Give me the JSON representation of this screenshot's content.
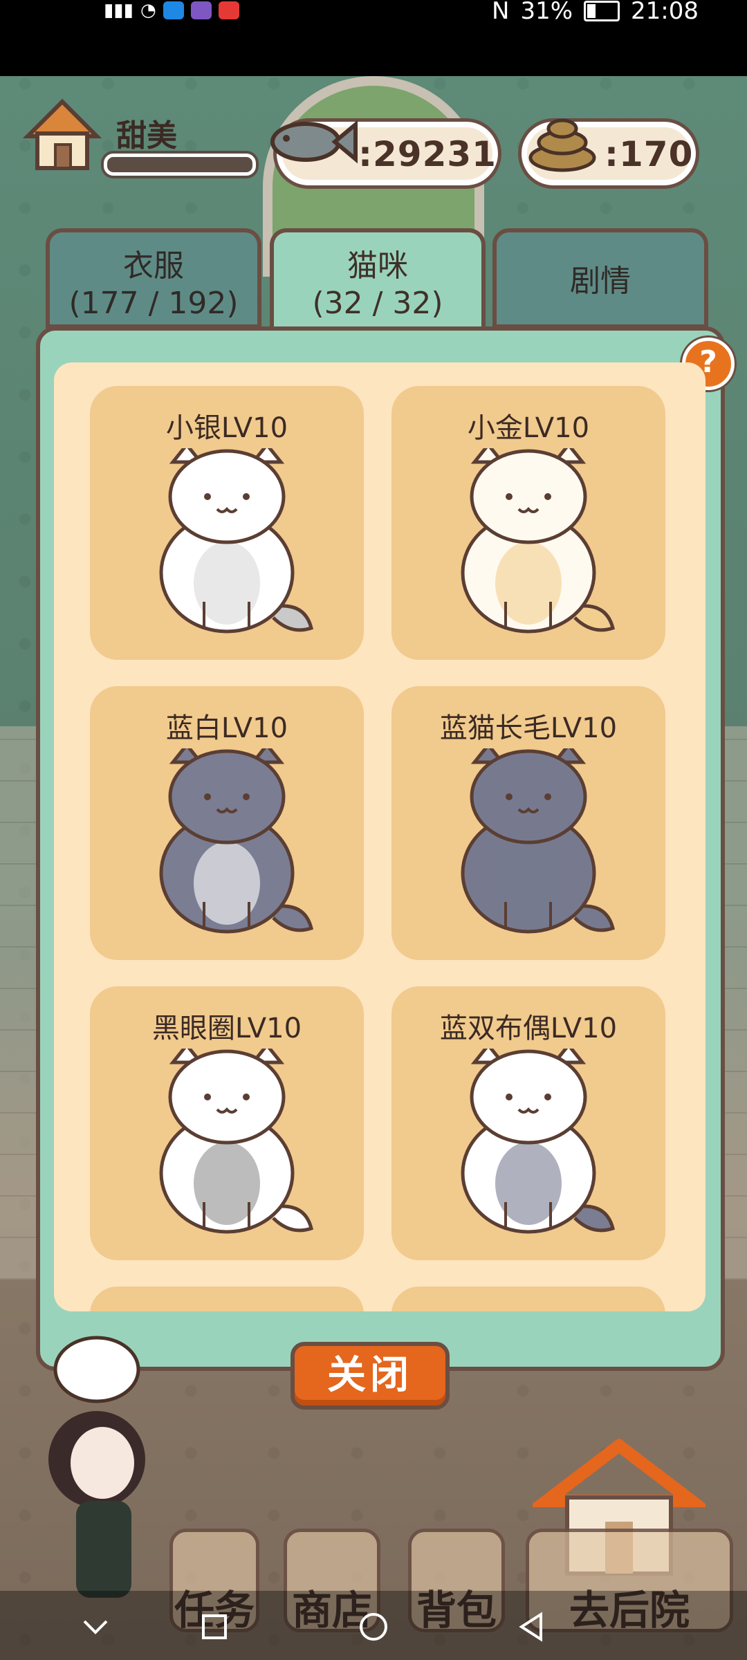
{
  "status_bar": {
    "battery": "31%",
    "time": "21:08"
  },
  "hud": {
    "player_name": "甜美",
    "fish_count": ":29231",
    "poop_count": ":170"
  },
  "tabs": [
    {
      "label": "衣服",
      "count": "(177 / 192)"
    },
    {
      "label": "猫咪",
      "count": "(32 / 32)"
    },
    {
      "label": "剧情",
      "count": ""
    }
  ],
  "help_label": "?",
  "cats": [
    {
      "title": "小银LV10",
      "body": "#ffffff",
      "patch": "#d9d9d9",
      "tail": "#c9c9c9"
    },
    {
      "title": "小金LV10",
      "body": "#fffaf0",
      "patch": "#f3cf8f",
      "tail": "#f3cf8f"
    },
    {
      "title": "蓝白LV10",
      "body": "#7b7d92",
      "patch": "#ffffff",
      "tail": "#7b7d92"
    },
    {
      "title": "蓝猫长毛LV10",
      "body": "#777a8f",
      "patch": "#777a8f",
      "tail": "#777a8f"
    },
    {
      "title": "黑眼圈LV10",
      "body": "#ffffff",
      "patch": "#8f8f8f",
      "tail": "#ffffff"
    },
    {
      "title": "蓝双布偶LV10",
      "body": "#ffffff",
      "patch": "#7b7d92",
      "tail": "#7b7d92"
    }
  ],
  "close_label": "关闭",
  "bottom_menu": [
    "任务",
    "商店",
    "背包",
    "去后院"
  ]
}
